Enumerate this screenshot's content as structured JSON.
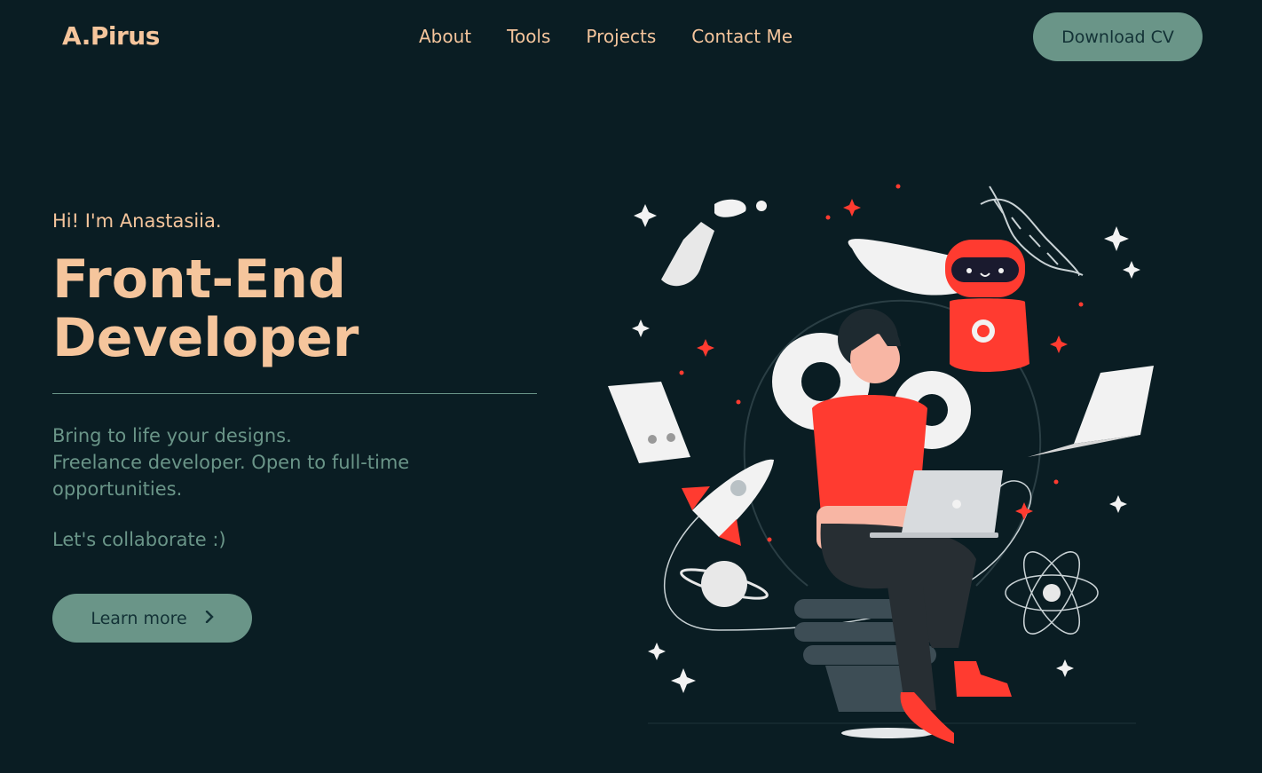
{
  "header": {
    "logo": "A.Pirus",
    "nav": [
      {
        "label": "About"
      },
      {
        "label": "Tools"
      },
      {
        "label": "Projects"
      },
      {
        "label": "Contact Me"
      }
    ],
    "download_label": "Download CV"
  },
  "hero": {
    "greeting": "Hi! I'm Anastasiia.",
    "title_line1": "Front-End",
    "title_line2": "Developer",
    "desc_line1": "Bring to life your designs.",
    "desc_line2": "Freelance developer. Open to full-time opportunities.",
    "collab": "Let's collaborate :)",
    "learn_more_label": "Learn more",
    "learn_more_icon": "chevron-right-icon"
  },
  "colors": {
    "background": "#0a1d23",
    "accent_peach": "#f5c59c",
    "accent_green": "#6a9588",
    "illustration_red": "#ff3b30"
  }
}
